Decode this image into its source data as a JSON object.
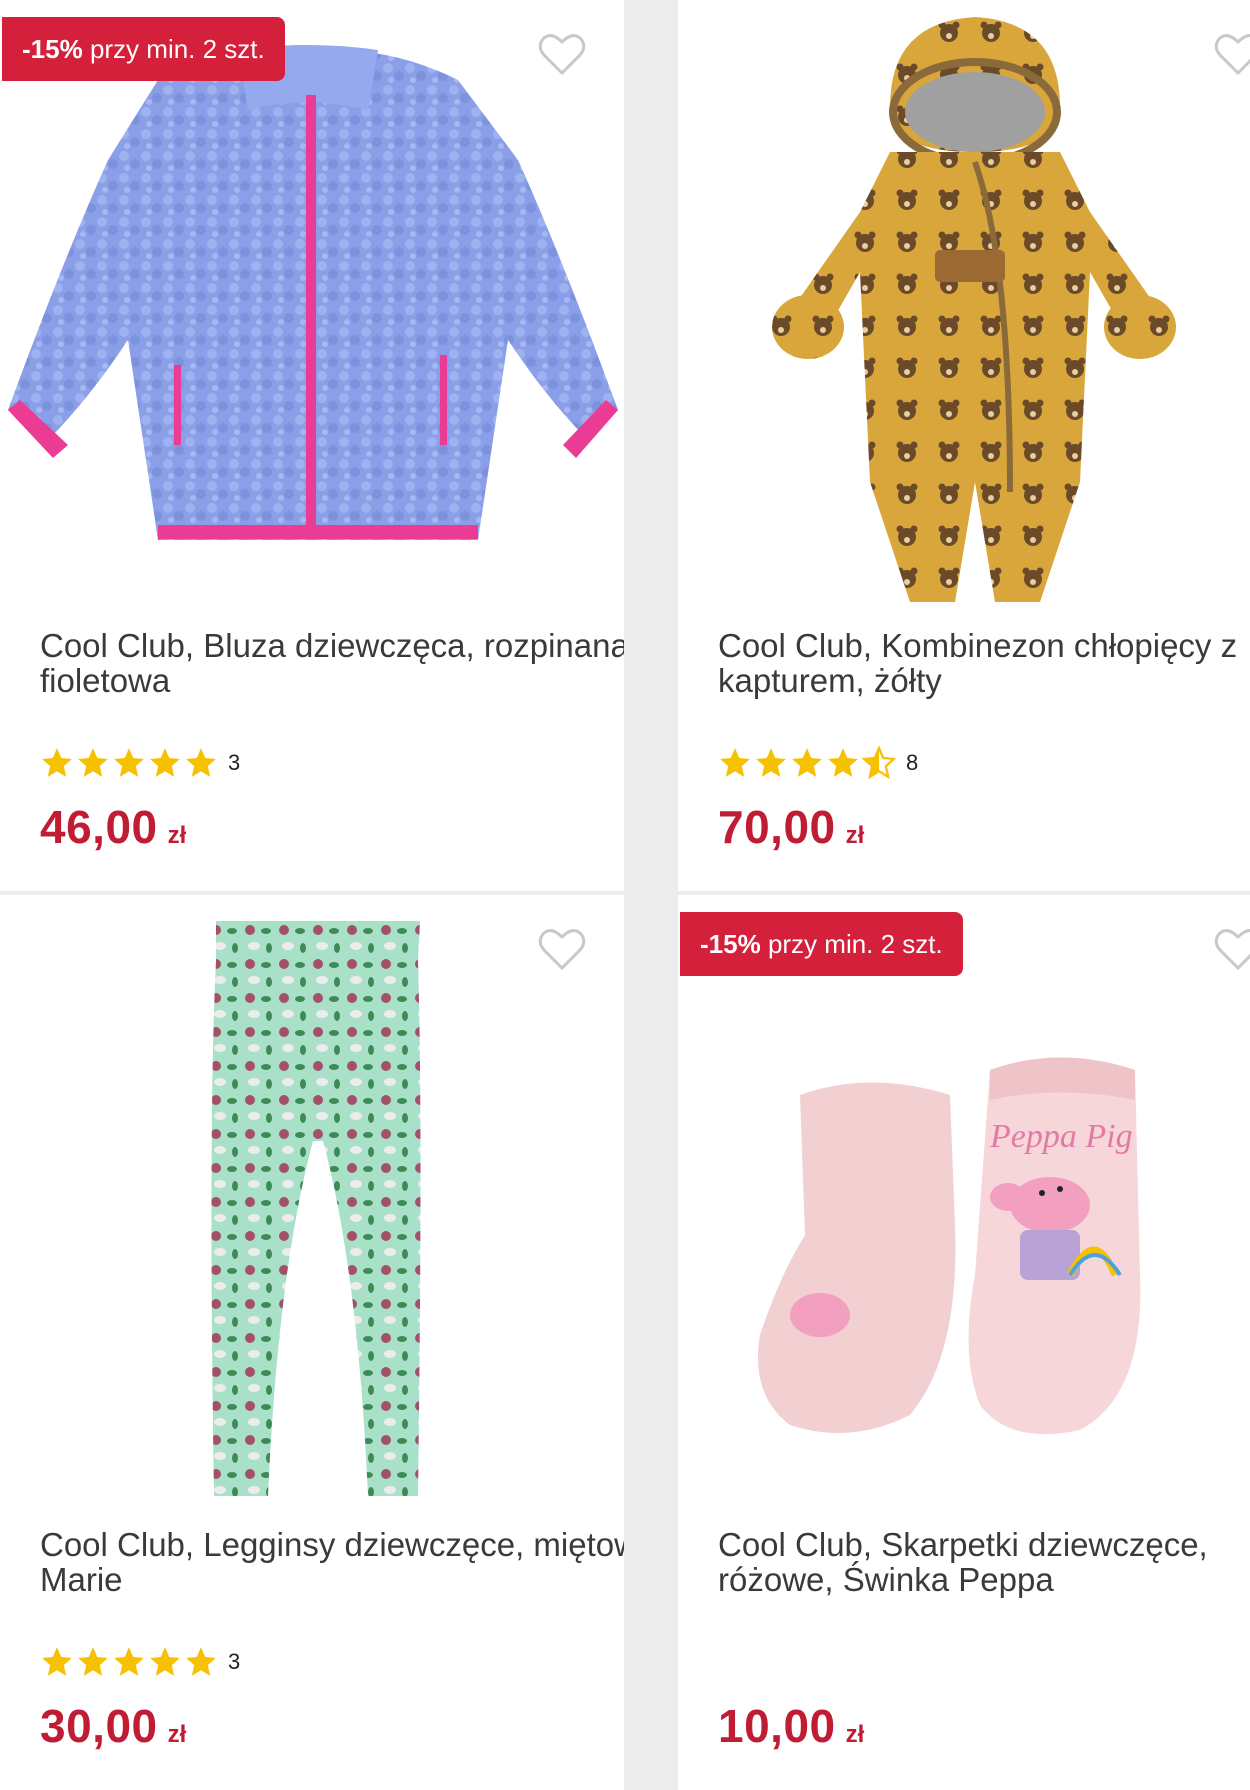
{
  "colors": {
    "page_bg": "#ececec",
    "card_bg": "#ffffff",
    "badge_bg": "#d5203b",
    "price": "#c01d35",
    "star_filled": "#f6c100",
    "heart_outline": "#c8c8c8"
  },
  "products": [
    {
      "badge": {
        "percent": "-15%",
        "text": "przy min. 2 szt."
      },
      "image_icon": "fleece-jacket-image",
      "title": "Cool Club, Bluza dziewczęca, rozpinana, fioletowa",
      "rating": {
        "value": 5,
        "count": "3"
      },
      "price": {
        "value": "46,00",
        "currency": "zł"
      }
    },
    {
      "badge": null,
      "image_icon": "snowsuit-image",
      "title": "Cool Club, Kombinezon chłopięcy z kapturem, żółty",
      "rating": {
        "value": 4.5,
        "count": "8"
      },
      "price": {
        "value": "70,00",
        "currency": "zł"
      }
    },
    {
      "badge": null,
      "image_icon": "leggings-image",
      "title": "Cool Club, Legginsy dziewczęce, miętowe, Marie",
      "rating": {
        "value": 5,
        "count": "3"
      },
      "price": {
        "value": "30,00",
        "currency": "zł"
      }
    },
    {
      "badge": {
        "percent": "-15%",
        "text": "przy min. 2 szt."
      },
      "image_icon": "socks-image",
      "title": "Cool Club, Skarpetki dziewczęce, różowe, Świnka Peppa",
      "image_text": "Peppa Pig",
      "rating": null,
      "price": {
        "value": "10,00",
        "currency": "zł"
      }
    }
  ]
}
